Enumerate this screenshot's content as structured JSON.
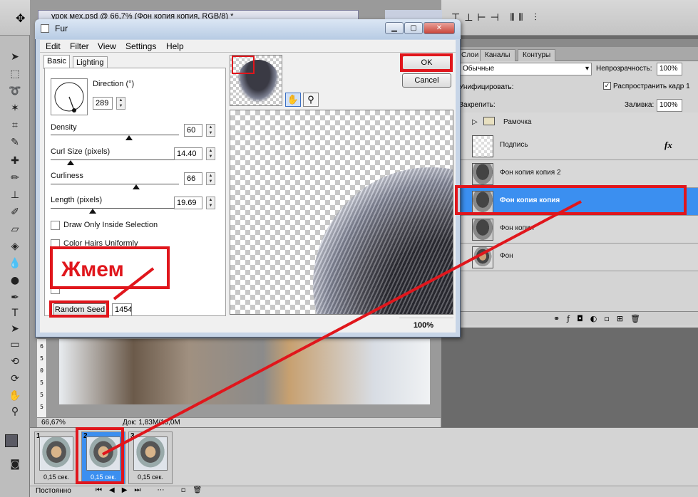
{
  "photoshop": {
    "document_tab": "урок мех.psd @ 66,7% (Фон копия  копия, RGB/8) *",
    "zoom_status": "66,67%",
    "doc_status": "Док: 1,83М/13,0М",
    "ruler_marks": [
      "6",
      "5",
      "0",
      "5",
      "5",
      "5"
    ],
    "panel_tabs": [
      "Слои",
      "Каналы",
      "Контуры"
    ],
    "blend_mode": "Обычные",
    "opacity_label": "Непрозрачность:",
    "opacity_value": "100%",
    "unify_label": "Унифицировать:",
    "propagate_label": "Распространить кадр 1",
    "lock_label": "Закрепить:",
    "fill_label": "Заливка:",
    "fill_value": "100%",
    "fx_label": "fx",
    "layers": [
      {
        "name": "Рамочка",
        "type": "folder"
      },
      {
        "name": "Подпись",
        "type": "text",
        "fx": true
      },
      {
        "name": "Фон копия  копия 2",
        "type": "fur"
      },
      {
        "name": "Фон копия  копия",
        "type": "fur",
        "selected": true
      },
      {
        "name": "Фон копия",
        "type": "fur"
      },
      {
        "name": "Фон",
        "type": "photo"
      }
    ]
  },
  "animation": {
    "frames": [
      {
        "num": "1",
        "time": "0,15 сек."
      },
      {
        "num": "2",
        "time": "0,15 сек.",
        "selected": true
      },
      {
        "num": "3",
        "time": "0,15 сек."
      }
    ],
    "loop": "Постоянно"
  },
  "fur": {
    "title": "Fur",
    "menu": [
      "Edit",
      "Filter",
      "View",
      "Settings",
      "Help"
    ],
    "tabs": [
      "Basic",
      "Lighting"
    ],
    "direction_label": "Direction (°)",
    "direction_value": "289",
    "density_label": "Density",
    "density_value": "60",
    "curl_label": "Curl Size (pixels)",
    "curl_value": "14.40",
    "curliness_label": "Curliness",
    "curliness_value": "66",
    "length_label": "Length (pixels)",
    "length_value": "19.69",
    "draw_inside_label": "Draw Only Inside Selection",
    "color_hairs_label": "Color Hairs Uniformly",
    "random_seed_button": "Random Seed",
    "random_seed_value": "1454",
    "ok_label": "OK",
    "cancel_label": "Cancel",
    "zoom": "100%"
  },
  "annotation": {
    "text": "Жмем",
    "color": "#e0161c"
  }
}
